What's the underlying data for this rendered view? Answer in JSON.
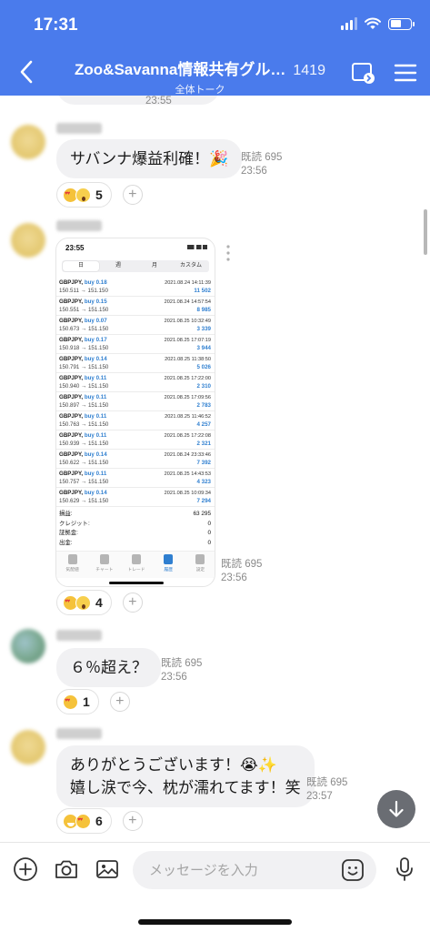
{
  "status_bar": {
    "time": "17:31"
  },
  "header": {
    "title": "Zoo&Savanna情報共有グル…",
    "member_count": "1419",
    "subtitle": "全体トーク"
  },
  "messages": {
    "prev_time": "23:55",
    "m1": {
      "text": "サバンナ爆益利確！🎉",
      "read": "既読 695",
      "time": "23:56",
      "reaction_count": "5"
    },
    "m2": {
      "read": "既読 695",
      "time": "23:56",
      "reaction_count": "4",
      "screenshot": {
        "time": "23:55",
        "segments": [
          "日",
          "週",
          "月",
          "カスタム"
        ],
        "selected_segment": "日",
        "trades": [
          {
            "pair": "GBPJPY,",
            "side": "buy 0.18",
            "prices": "150.511 → 151.150",
            "date": "2021.08.24 14:11:39",
            "profit": "11 502"
          },
          {
            "pair": "GBPJPY,",
            "side": "buy 0.15",
            "prices": "150.551 → 151.150",
            "date": "2021.08.24 14:57:54",
            "profit": "8 985"
          },
          {
            "pair": "GBPJPY,",
            "side": "buy 0.07",
            "prices": "150.673 → 151.150",
            "date": "2021.08.25 10:32:49",
            "profit": "3 339"
          },
          {
            "pair": "GBPJPY,",
            "side": "buy 0.17",
            "prices": "150.918 → 151.150",
            "date": "2021.08.25 17:07:19",
            "profit": "3 944"
          },
          {
            "pair": "GBPJPY,",
            "side": "buy 0.14",
            "prices": "150.791 → 151.150",
            "date": "2021.08.25 11:38:50",
            "profit": "5 026"
          },
          {
            "pair": "GBPJPY,",
            "side": "buy 0.11",
            "prices": "150.940 → 151.150",
            "date": "2021.08.25 17:22:00",
            "profit": "2 310"
          },
          {
            "pair": "GBPJPY,",
            "side": "buy 0.11",
            "prices": "150.897 → 151.150",
            "date": "2021.08.25 17:09:56",
            "profit": "2 783"
          },
          {
            "pair": "GBPJPY,",
            "side": "buy 0.11",
            "prices": "150.763 → 151.150",
            "date": "2021.08.25 11:46:52",
            "profit": "4 257"
          },
          {
            "pair": "GBPJPY,",
            "side": "buy 0.11",
            "prices": "150.939 → 151.150",
            "date": "2021.08.25 17:22:08",
            "profit": "2 321"
          },
          {
            "pair": "GBPJPY,",
            "side": "buy 0.14",
            "prices": "150.622 → 151.150",
            "date": "2021.08.24 23:33:46",
            "profit": "7 392"
          },
          {
            "pair": "GBPJPY,",
            "side": "buy 0.11",
            "prices": "150.757 → 151.150",
            "date": "2021.08.25 14:43:53",
            "profit": "4 323"
          },
          {
            "pair": "GBPJPY,",
            "side": "buy 0.14",
            "prices": "150.629 → 151.150",
            "date": "2021.08.25 10:09:34",
            "profit": "7 294"
          }
        ],
        "totals": [
          {
            "label": "損益:",
            "value": "63 295"
          },
          {
            "label": "クレジット:",
            "value": "0"
          },
          {
            "label": "証拠金:",
            "value": "0"
          },
          {
            "label": "出金:",
            "value": "0"
          }
        ],
        "tabs": [
          "気配値",
          "チャート",
          "トレード",
          "履歴",
          "設定"
        ],
        "active_tab": "履歴"
      }
    },
    "m3": {
      "text": "６％超え？",
      "read": "既読 695",
      "time": "23:56",
      "reaction_count": "1"
    },
    "m4": {
      "line1": "ありがとうございます！😭✨",
      "line2": "嬉し涙で今、枕が濡れてます！笑",
      "read": "既読 695",
      "time": "23:57",
      "reaction_count": "6"
    }
  },
  "input": {
    "placeholder": "メッセージを入力"
  },
  "colors": {
    "header_bg": "#4a7bec",
    "bubble_bg": "#f1f1f3",
    "profit_blue": "#2f7fd0"
  },
  "icons": [
    "back-icon",
    "note-icon",
    "menu-icon",
    "plus-icon",
    "camera-icon",
    "image-icon",
    "emoji-icon",
    "mic-icon",
    "arrow-down-icon"
  ]
}
